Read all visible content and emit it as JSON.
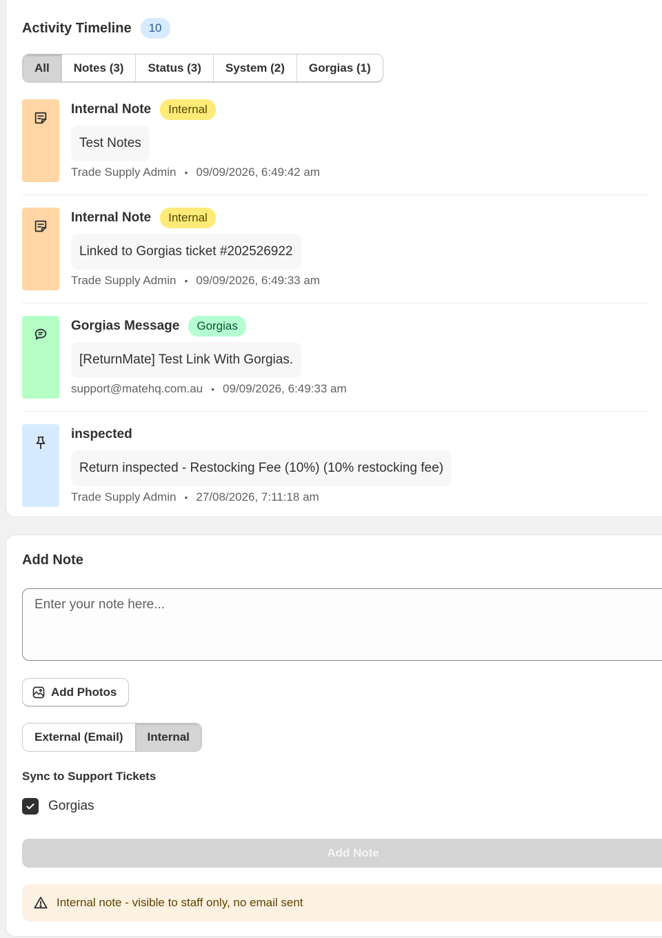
{
  "timeline": {
    "title": "Activity Timeline",
    "count": "10",
    "filters": [
      "All",
      "Notes (3)",
      "Status (3)",
      "System (2)",
      "Gorgias (1)"
    ],
    "active_filter": "All",
    "entries": [
      {
        "title": "Internal Note",
        "tag": "Internal",
        "text": "Test Notes",
        "author": "Trade Supply Admin",
        "timestamp": "09/09/2026, 6:49:42 am",
        "icon": "note-icon",
        "color": "#ffd6a4"
      },
      {
        "title": "Internal Note",
        "tag": "Internal",
        "text": "Linked to Gorgias ticket #202526922",
        "author": "Trade Supply Admin",
        "timestamp": "09/09/2026, 6:49:33 am",
        "icon": "note-icon",
        "color": "#ffd6a4"
      },
      {
        "title": "Gorgias Message",
        "tag": "Gorgias",
        "text": "[ReturnMate] Test Link With Gorgias.",
        "author": "support@matehq.com.au",
        "timestamp": "09/09/2026, 6:49:33 am",
        "icon": "chat-icon",
        "color": "#b4fec5"
      },
      {
        "title": "inspected",
        "tag": "",
        "text": "Return inspected - Restocking Fee (10%) (10% restocking fee)",
        "author": "Trade Supply Admin",
        "timestamp": "27/08/2026, 7:11:18 am",
        "icon": "pin-icon",
        "color": "#d6ebff"
      }
    ]
  },
  "add_note": {
    "title": "Add Note",
    "placeholder": "Enter your note here...",
    "photos_label": "Add Photos",
    "modes": [
      "External (Email)",
      "Internal"
    ],
    "active_mode": "Internal",
    "sync_label": "Sync to Support Tickets",
    "sync_option": "Gorgias",
    "sync_checked": true,
    "submit_label": "Add Note",
    "notice": "Internal note - visible to staff only, no email sent"
  },
  "colors": {
    "internal_tag": "#ffeb78",
    "gorgias_tag": "#b4fed2",
    "count_badge": "#d6ebff",
    "notice_bg": "#fdf1e2"
  }
}
